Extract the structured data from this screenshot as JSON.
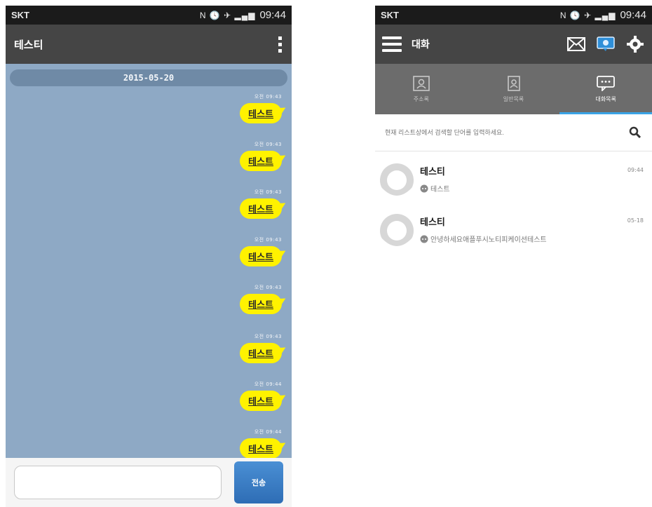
{
  "status_bar": {
    "carrier": "SKT",
    "icons": "N 🕓 ✈ ▂▄▆",
    "time": "09:44"
  },
  "left": {
    "title": "테스티",
    "date": "2015-05-20",
    "message_stamps": [
      "오전 09:43",
      "오전 09:43",
      "오전 09:43",
      "오전 09:43",
      "오전 09:43",
      "오전 09:43",
      "오전 09:44",
      "오전 09:44"
    ],
    "messages": [
      "테스트",
      "테스트",
      "테스트",
      "테스트",
      "테스트",
      "테스트",
      "테스트",
      "테스트"
    ],
    "send_label": "전송"
  },
  "right": {
    "title": "대화",
    "tabs": [
      {
        "label": "주소록",
        "active": false
      },
      {
        "label": "일반목록",
        "active": false
      },
      {
        "label": "대화목록",
        "active": true
      }
    ],
    "search_placeholder": "현재 리스트상에서 검색할 단어를 입력하세요.",
    "conversations": [
      {
        "name": "테스티",
        "preview": "테스트",
        "time": "09:44"
      },
      {
        "name": "테스티",
        "preview": "안녕하세요애플푸시노티피케이션테스트",
        "time": "05-18"
      }
    ]
  },
  "colors": {
    "chat_bg": "#8ea9c5",
    "bubble": "#fff200",
    "header": "#454545",
    "tab_active": "#3aa4e6"
  }
}
